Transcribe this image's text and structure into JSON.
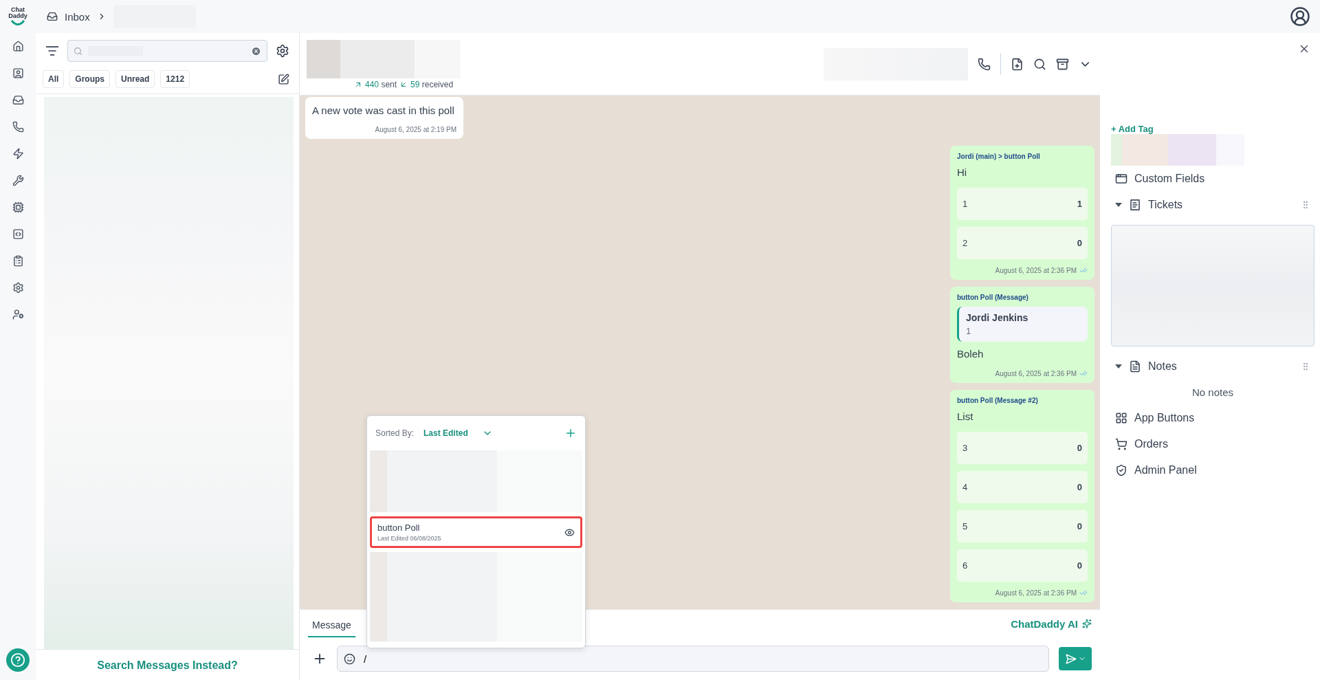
{
  "logo": {
    "line_1": "Chat",
    "line_2": "Daddy"
  },
  "breadcrumb": {
    "items": [
      "Inbox"
    ]
  },
  "conversation_list": {
    "filters": [
      {
        "label": "All"
      },
      {
        "label": "Groups"
      },
      {
        "label": "Unread"
      },
      {
        "label": "1212"
      }
    ],
    "search_link": "Search Messages Instead?"
  },
  "chat": {
    "stats": {
      "sent": "440",
      "sent_label": "sent",
      "received": "59",
      "received_label": "received"
    },
    "messages": [
      {
        "kind": "received_text",
        "text": "A new vote was cast in this poll",
        "time": "August 6, 2025 at 2:19 PM"
      },
      {
        "kind": "sent_poll",
        "header": "Jordi (main) > button Poll",
        "question": "Hi",
        "options": [
          {
            "label": "1",
            "votes": "1"
          },
          {
            "label": "2",
            "votes": "0"
          }
        ],
        "time": "August 6, 2025 at 2:36 PM"
      },
      {
        "kind": "sent_reply",
        "header": "button Poll (Message)",
        "quote": {
          "author": "Jordi Jenkins",
          "text": "1"
        },
        "text": "Boleh",
        "time": "August 6, 2025 at 2:36 PM"
      },
      {
        "kind": "sent_poll",
        "header": "button Poll (Message #2)",
        "question": "List",
        "options": [
          {
            "label": "3",
            "votes": "0"
          },
          {
            "label": "4",
            "votes": "0"
          },
          {
            "label": "5",
            "votes": "0"
          },
          {
            "label": "6",
            "votes": "0"
          }
        ],
        "time": "August 6, 2025 at 2:36 PM"
      }
    ],
    "composer": {
      "tabs": [
        {
          "label": "Message",
          "selected": true
        }
      ],
      "ai_label": "ChatDaddy AI",
      "value": "/"
    }
  },
  "template_popup": {
    "sort_label": "Sorted By:",
    "sort_value": "Last Edited",
    "items": [
      {
        "kind": "redacted",
        "selected": false
      },
      {
        "kind": "template",
        "title": "button Poll",
        "subtitle": "Last Edited 06/08/2025",
        "selected": true
      },
      {
        "kind": "redacted",
        "selected": false
      }
    ]
  },
  "contact_panel": {
    "add_tag": "+ Add Tag",
    "sections": [
      {
        "kind": "link",
        "label": "Custom Fields"
      },
      {
        "kind": "collapsible",
        "label": "Tickets",
        "expanded": true
      },
      {
        "kind": "collapsible",
        "label": "Notes",
        "expanded": true,
        "empty_text": "No notes"
      },
      {
        "kind": "link",
        "label": "App Buttons"
      },
      {
        "kind": "link",
        "label": "Orders"
      },
      {
        "kind": "link",
        "label": "Admin Panel"
      }
    ]
  }
}
